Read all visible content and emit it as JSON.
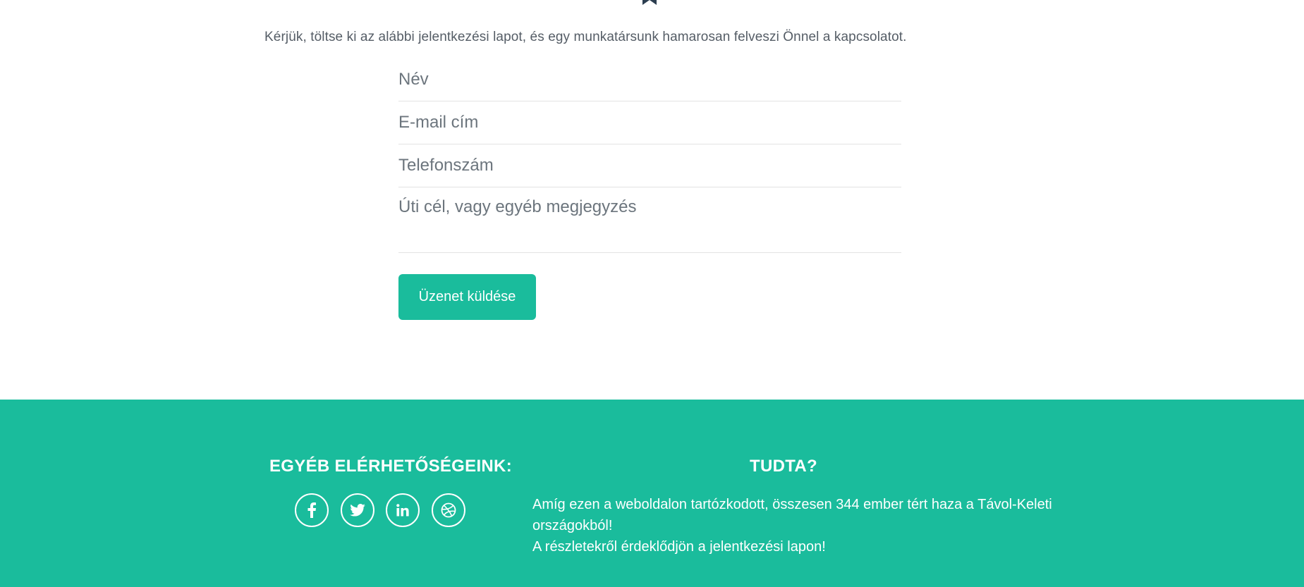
{
  "intro": {
    "text": "Kérjük, töltse ki az alábbi jelentkezési lapot, és egy munkatársunk hamarosan felveszi Önnel a kapcsolatot."
  },
  "form": {
    "name_placeholder": "Név",
    "email_placeholder": "E-mail cím",
    "phone_placeholder": "Telefonszám",
    "message_placeholder": "Úti cél, vagy egyéb megjegyzés",
    "submit_label": "Üzenet küldése"
  },
  "footer": {
    "contacts_title": "EGYÉB ELÉRHETŐSÉGEINK:",
    "social_icons": [
      "facebook-icon",
      "twitter-icon",
      "linkedin-icon",
      "dribbble-icon"
    ],
    "fact_title": "TUDTA?",
    "fact_lines": [
      "Amíg ezen a weboldalon tartózkodott, összesen 344 ember tért haza a Távol-Keleti",
      "országokból!",
      "A részletekről érdeklődjön a jelentkezési lapon!"
    ]
  },
  "colors": {
    "accent": "#1abc9c",
    "text": "#2c3e50",
    "muted": "#6c757d"
  }
}
